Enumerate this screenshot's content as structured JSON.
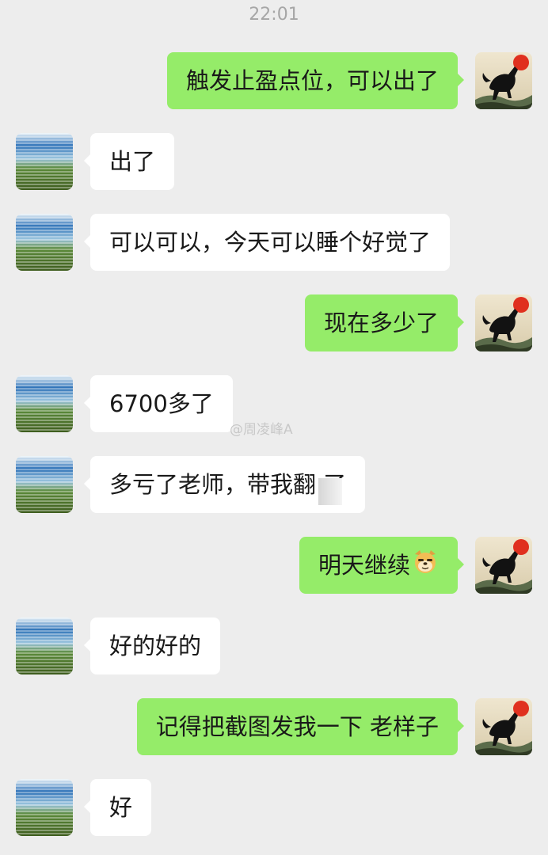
{
  "status": {
    "time": "22:01"
  },
  "watermark": "@周凌峰A",
  "avatars": {
    "me": "horse-painting-avatar",
    "peer": "landscape-avatar"
  },
  "colors": {
    "me_bubble": "#95ec69",
    "peer_bubble": "#ffffff",
    "background": "#ededed"
  },
  "messages": [
    {
      "from": "me",
      "text": "触发止盈点位，可以出了"
    },
    {
      "from": "peer",
      "text": "出了"
    },
    {
      "from": "peer",
      "text": "可以可以，今天可以睡个好觉了"
    },
    {
      "from": "me",
      "text": "现在多少了"
    },
    {
      "from": "peer",
      "text": "6700多了"
    },
    {
      "from": "peer",
      "text": "多亏了老师，带我翻 了"
    },
    {
      "from": "me",
      "text": "明天继续",
      "emoji": "smirking-dog-emoji"
    },
    {
      "from": "peer",
      "text": "好的好的"
    },
    {
      "from": "me",
      "text": "记得把截图发我一下 老样子"
    },
    {
      "from": "peer",
      "text": "好"
    }
  ]
}
